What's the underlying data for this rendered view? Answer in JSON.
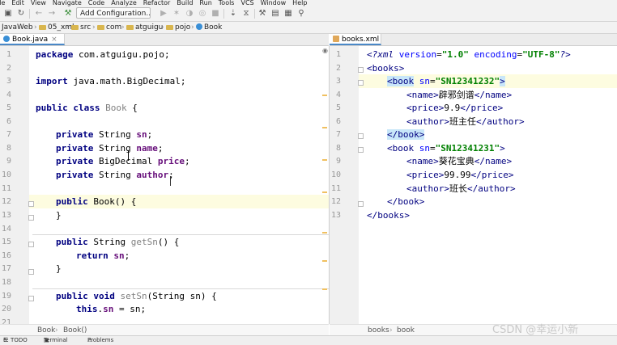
{
  "menu": [
    "ile",
    "Edit",
    "View",
    "Navigate",
    "Code",
    "Analyze",
    "Refactor",
    "Build",
    "Run",
    "Tools",
    "VCS",
    "Window",
    "Help"
  ],
  "toolbar": {
    "config_label": "Add Configuration..."
  },
  "breadcrumb": [
    "JavaWeb",
    "05_xml",
    "src",
    "com",
    "atguigu",
    "pojo",
    "Book"
  ],
  "left_tab": {
    "label": "Book.java",
    "close": "×"
  },
  "right_tab": {
    "label": "books.xml"
  },
  "java": {
    "line_numbers": [
      "1",
      "2",
      "3",
      "4",
      "5",
      "6",
      "7",
      "8",
      "9",
      "10",
      "11",
      "12",
      "13",
      "14",
      "15",
      "16",
      "17",
      "18",
      "19",
      "20",
      "21"
    ],
    "l1_kw": "package",
    "l1_rest": " com.atguigu.pojo;",
    "l3_kw": "import",
    "l3_rest": " java.math.BigDecimal;",
    "l5_kw1": "public",
    "l5_kw2": "class",
    "l5_name": "Book",
    "l5_brace": " {",
    "l7_kw": "private",
    "l7_type": " String ",
    "l7_field": "sn",
    "l7_end": ";",
    "l8_kw": "private",
    "l8_type": " String ",
    "l8_field": "name",
    "l8_end": ";",
    "l9_kw": "private",
    "l9_type": " BigDecimal ",
    "l9_field": "price",
    "l9_end": ";",
    "l10_kw": "private",
    "l10_type": " String ",
    "l10_field": "author",
    "l10_end": ";",
    "l12_kw": "public",
    "l12_rest": " Book() {",
    "l13": "}",
    "l15_kw": "public",
    "l15_type": " String ",
    "l15_name": "getSn",
    "l15_rest": "() {",
    "l16_kw": "return",
    "l16_field": "sn",
    "l16_end": ";",
    "l17": "}",
    "l19_kw1": "public",
    "l19_kw2": "void",
    "l19_name": "setSn",
    "l19_rest": "(String sn) {",
    "l20_kw": "this",
    "l20_field": "sn",
    "l20_rest": " = sn;",
    "footer": [
      "Book",
      "Book()"
    ]
  },
  "xml": {
    "line_numbers": [
      "1",
      "2",
      "3",
      "4",
      "5",
      "6",
      "7",
      "8",
      "9",
      "10",
      "11",
      "12",
      "13"
    ],
    "l1_open": "<?",
    "l1_tag": "xml",
    "l1_a1": "version",
    "l1_v1": "\"1.0\"",
    "l1_a2": "encoding",
    "l1_v2": "\"UTF-8\"",
    "l1_close": "?>",
    "l2": "<books>",
    "l3_tag": "<book",
    "l3_attr": "sn",
    "l3_val": "\"SN12341232\"",
    "l3_end": ">",
    "l4_open": "<name>",
    "l4_text": "辟邪剑谱",
    "l4_close": "</name>",
    "l5_open": "<price>",
    "l5_text": "9.9",
    "l5_close": "</price>",
    "l6_open": "<author>",
    "l6_text": "班主任",
    "l6_close": "</author>",
    "l7": "</book>",
    "l8_tag": "<book",
    "l8_attr": "sn",
    "l8_val": "\"SN12341231\"",
    "l8_end": ">",
    "l9_open": "<name>",
    "l9_text": "葵花宝典",
    "l9_close": "</name>",
    "l10_open": "<price>",
    "l10_text": "99.99",
    "l10_close": "</price>",
    "l11_open": "<author>",
    "l11_text": "班长",
    "l11_close": "</author>",
    "l12": "</book>",
    "l13": "</books>",
    "footer": [
      "books",
      "book"
    ]
  },
  "status": {
    "todo": "6: TODO",
    "terminal": "Terminal",
    "problems": "Problems"
  },
  "watermark": "CSDN @幸运小新"
}
